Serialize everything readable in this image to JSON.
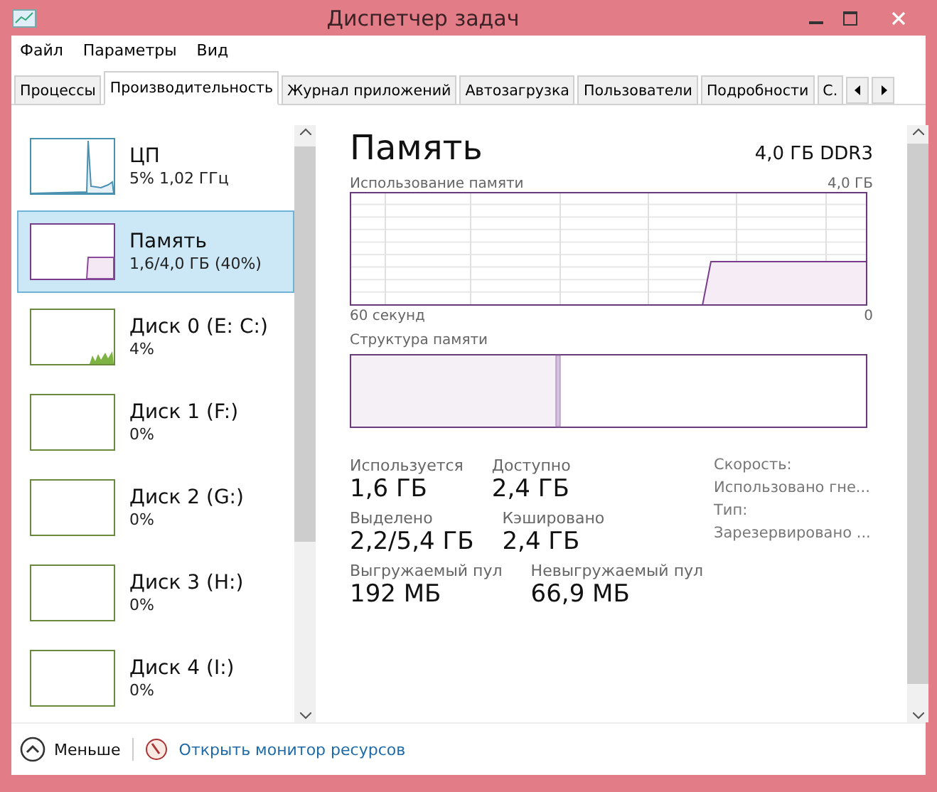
{
  "window": {
    "title": "Диспетчер задач"
  },
  "menu": [
    "Файл",
    "Параметры",
    "Вид"
  ],
  "tabs": [
    {
      "label": "Процессы",
      "selected": false
    },
    {
      "label": "Производительность",
      "selected": true
    },
    {
      "label": "Журнал приложений",
      "selected": false
    },
    {
      "label": "Автозагрузка",
      "selected": false
    },
    {
      "label": "Пользователи",
      "selected": false
    },
    {
      "label": "Подробности",
      "selected": false
    },
    {
      "label": "С.",
      "selected": false
    }
  ],
  "sidebar": {
    "items": [
      {
        "kind": "cpu",
        "name": "ЦП",
        "detail": "5% 1,02 ГГц",
        "selected": false
      },
      {
        "kind": "memory",
        "name": "Память",
        "detail": "1,6/4,0 ГБ (40%)",
        "selected": true
      },
      {
        "kind": "disk",
        "name": "Диск 0 (E: C:)",
        "detail": "4%",
        "selected": false,
        "active": true
      },
      {
        "kind": "disk",
        "name": "Диск 1 (F:)",
        "detail": "0%",
        "selected": false,
        "active": false
      },
      {
        "kind": "disk",
        "name": "Диск 2 (G:)",
        "detail": "0%",
        "selected": false,
        "active": false
      },
      {
        "kind": "disk",
        "name": "Диск 3 (H:)",
        "detail": "0%",
        "selected": false,
        "active": false
      },
      {
        "kind": "disk",
        "name": "Диск 4 (I:)",
        "detail": "0%",
        "selected": false,
        "active": false
      }
    ]
  },
  "detail": {
    "title": "Память",
    "spec": "4,0 ГБ DDR3",
    "usage_label": "Использование памяти",
    "usage_max": "4,0 ГБ",
    "time_start": "60 секунд",
    "time_end": "0",
    "structure_label": "Структура памяти",
    "stats": [
      [
        {
          "label": "Используется",
          "value": "1,6 ГБ"
        },
        {
          "label": "Доступно",
          "value": "2,4 ГБ"
        }
      ],
      [
        {
          "label": "Выделено",
          "value": "2,2/5,4 ГБ"
        },
        {
          "label": "Кэшировано",
          "value": "2,4 ГБ"
        }
      ],
      [
        {
          "label": "Выгружаемый пул",
          "value": "192 МБ"
        },
        {
          "label": "Невыгружаемый пул",
          "value": "66,9 МБ"
        }
      ]
    ],
    "side_labels": [
      "Скорость:",
      "Использовано гне...",
      "Тип:",
      "Зарезервировано ..."
    ]
  },
  "footer": {
    "less": "Меньше",
    "link": "Открыть монитор ресурсов"
  }
}
